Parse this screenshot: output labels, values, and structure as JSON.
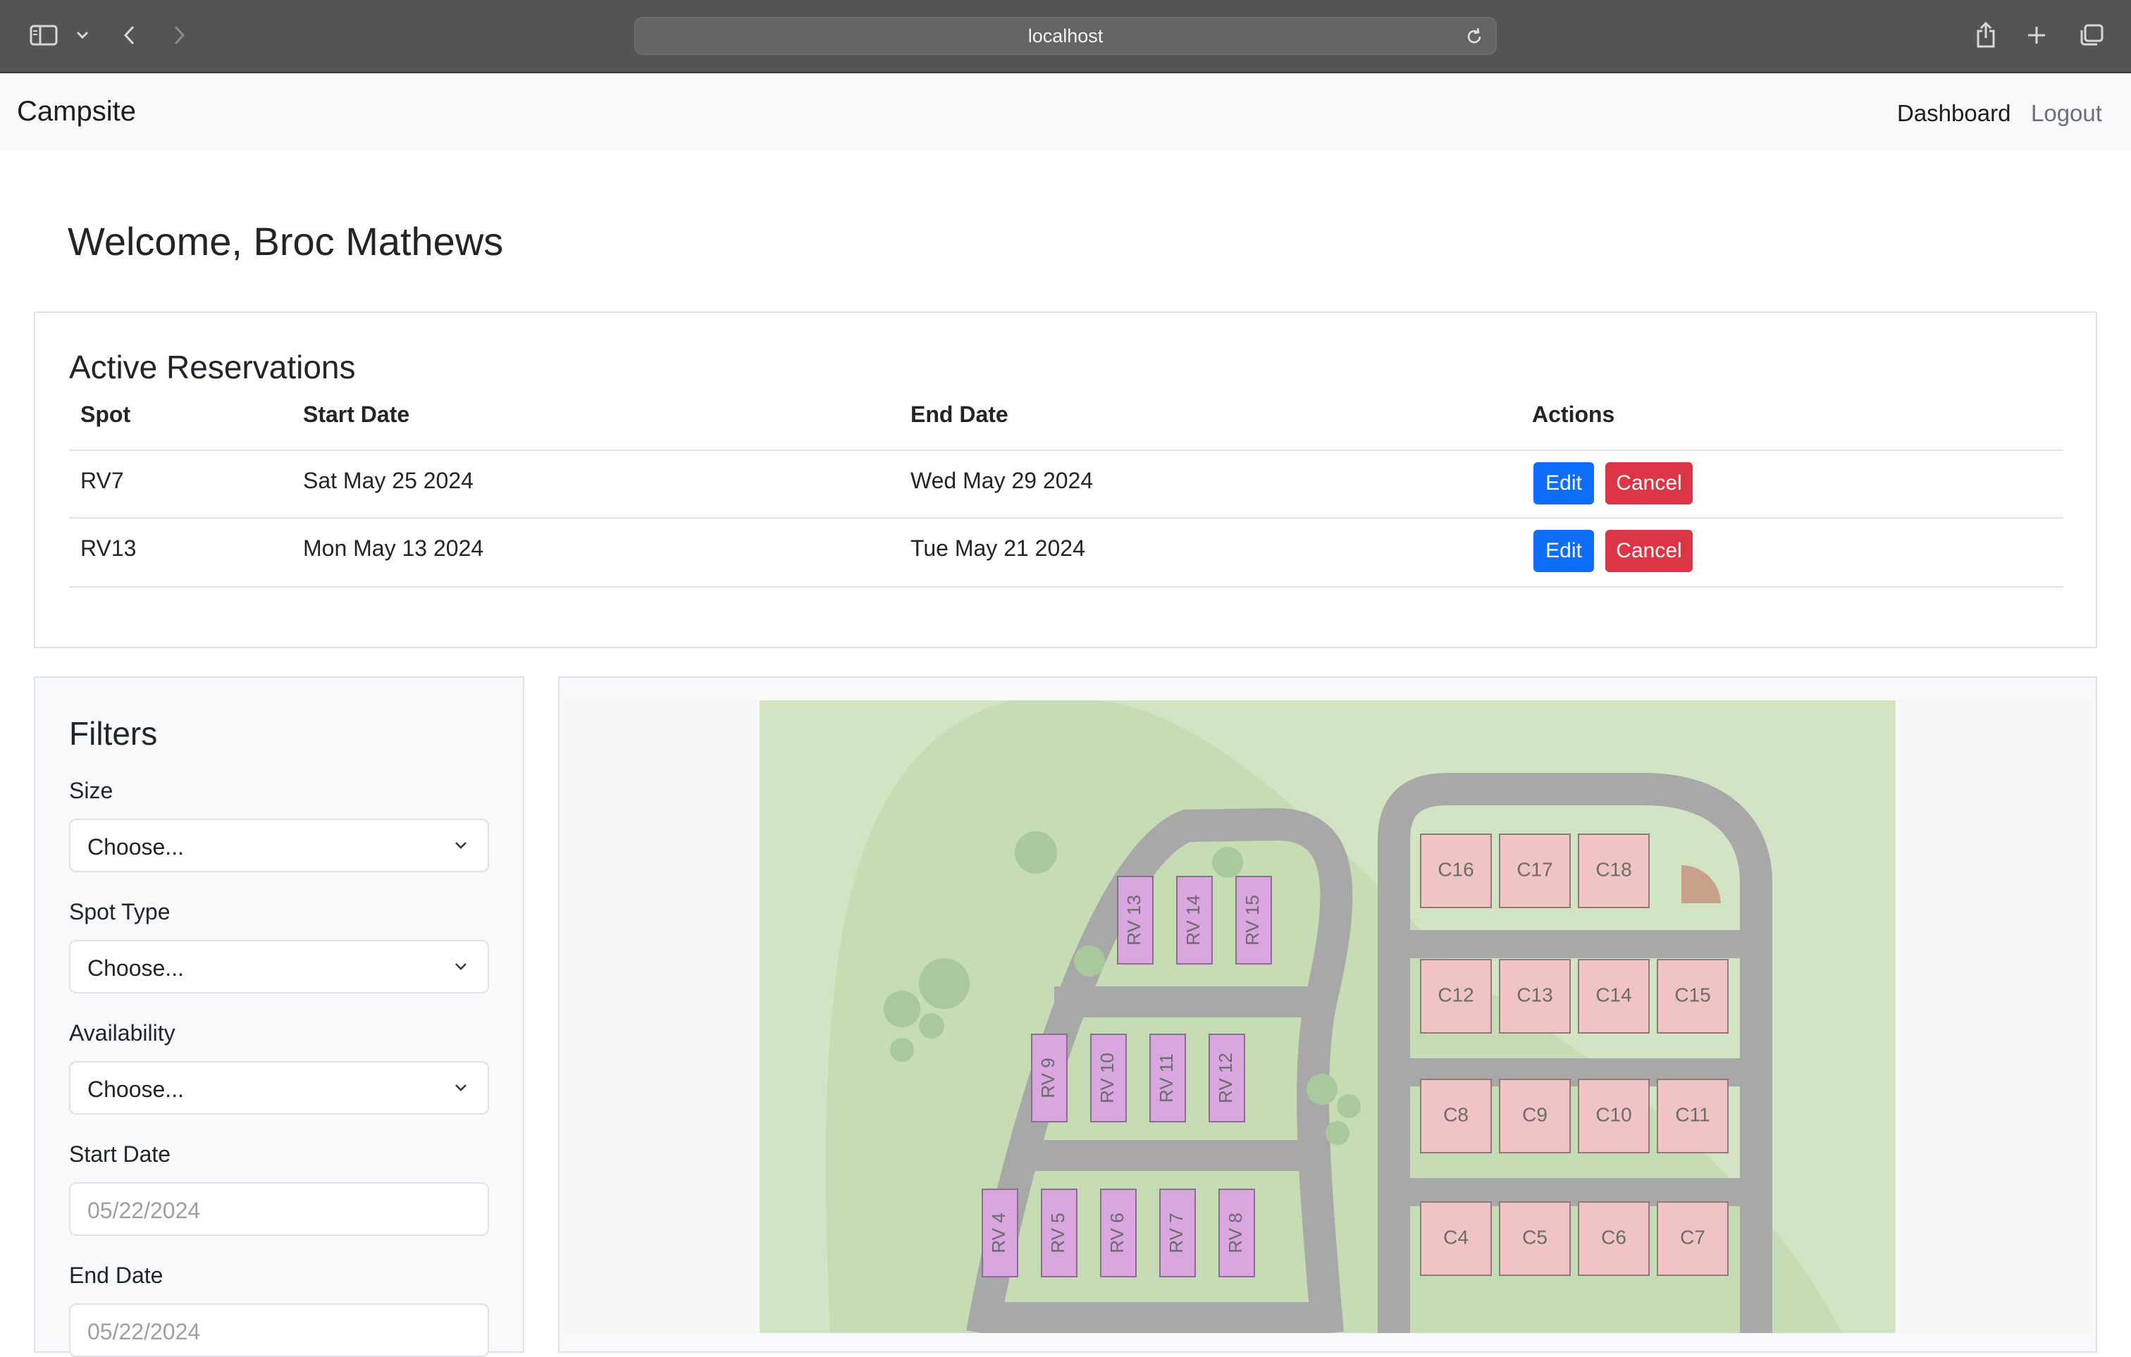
{
  "browser": {
    "url": "localhost"
  },
  "nav": {
    "brand": "Campsite",
    "dashboard": "Dashboard",
    "logout": "Logout"
  },
  "welcome": "Welcome, Broc Mathews",
  "reservations": {
    "title": "Active Reservations",
    "columns": [
      "Spot",
      "Start Date",
      "End Date",
      "Actions"
    ],
    "rows": [
      {
        "spot": "RV7",
        "start": "Sat May 25 2024",
        "end": "Wed May 29 2024",
        "edit": "Edit",
        "cancel": "Cancel"
      },
      {
        "spot": "RV13",
        "start": "Mon May 13 2024",
        "end": "Tue May 21 2024",
        "edit": "Edit",
        "cancel": "Cancel"
      }
    ]
  },
  "filters": {
    "title": "Filters",
    "size": {
      "label": "Size",
      "value": "Choose..."
    },
    "spot_type": {
      "label": "Spot Type",
      "value": "Choose..."
    },
    "availability": {
      "label": "Availability",
      "value": "Choose..."
    },
    "start_date": {
      "label": "Start Date",
      "value": "05/22/2024"
    },
    "end_date": {
      "label": "End Date",
      "value": "05/22/2024"
    }
  },
  "map": {
    "rv_spots": [
      "RV 13",
      "RV 14",
      "RV 15",
      "RV 9",
      "RV 10",
      "RV 11",
      "RV 12",
      "RV 4",
      "RV 5",
      "RV 6",
      "RV 7",
      "RV 8"
    ],
    "cabin_spots": [
      "C16",
      "C17",
      "C18",
      "C12",
      "C13",
      "C14",
      "C15",
      "C8",
      "C9",
      "C10",
      "C11",
      "C4",
      "C5",
      "C6",
      "C7"
    ],
    "colors": {
      "grass": "#d2e4c4",
      "grass_dark": "#c5dcb5",
      "road": "#a8a8a8",
      "rv": "#d9a6e0",
      "cabin": "#f0c4c4",
      "tree": "#a9c99c"
    }
  },
  "colors": {
    "primary": "#0d6efd",
    "danger": "#dc3545",
    "navbar": "#f8f9fa"
  }
}
